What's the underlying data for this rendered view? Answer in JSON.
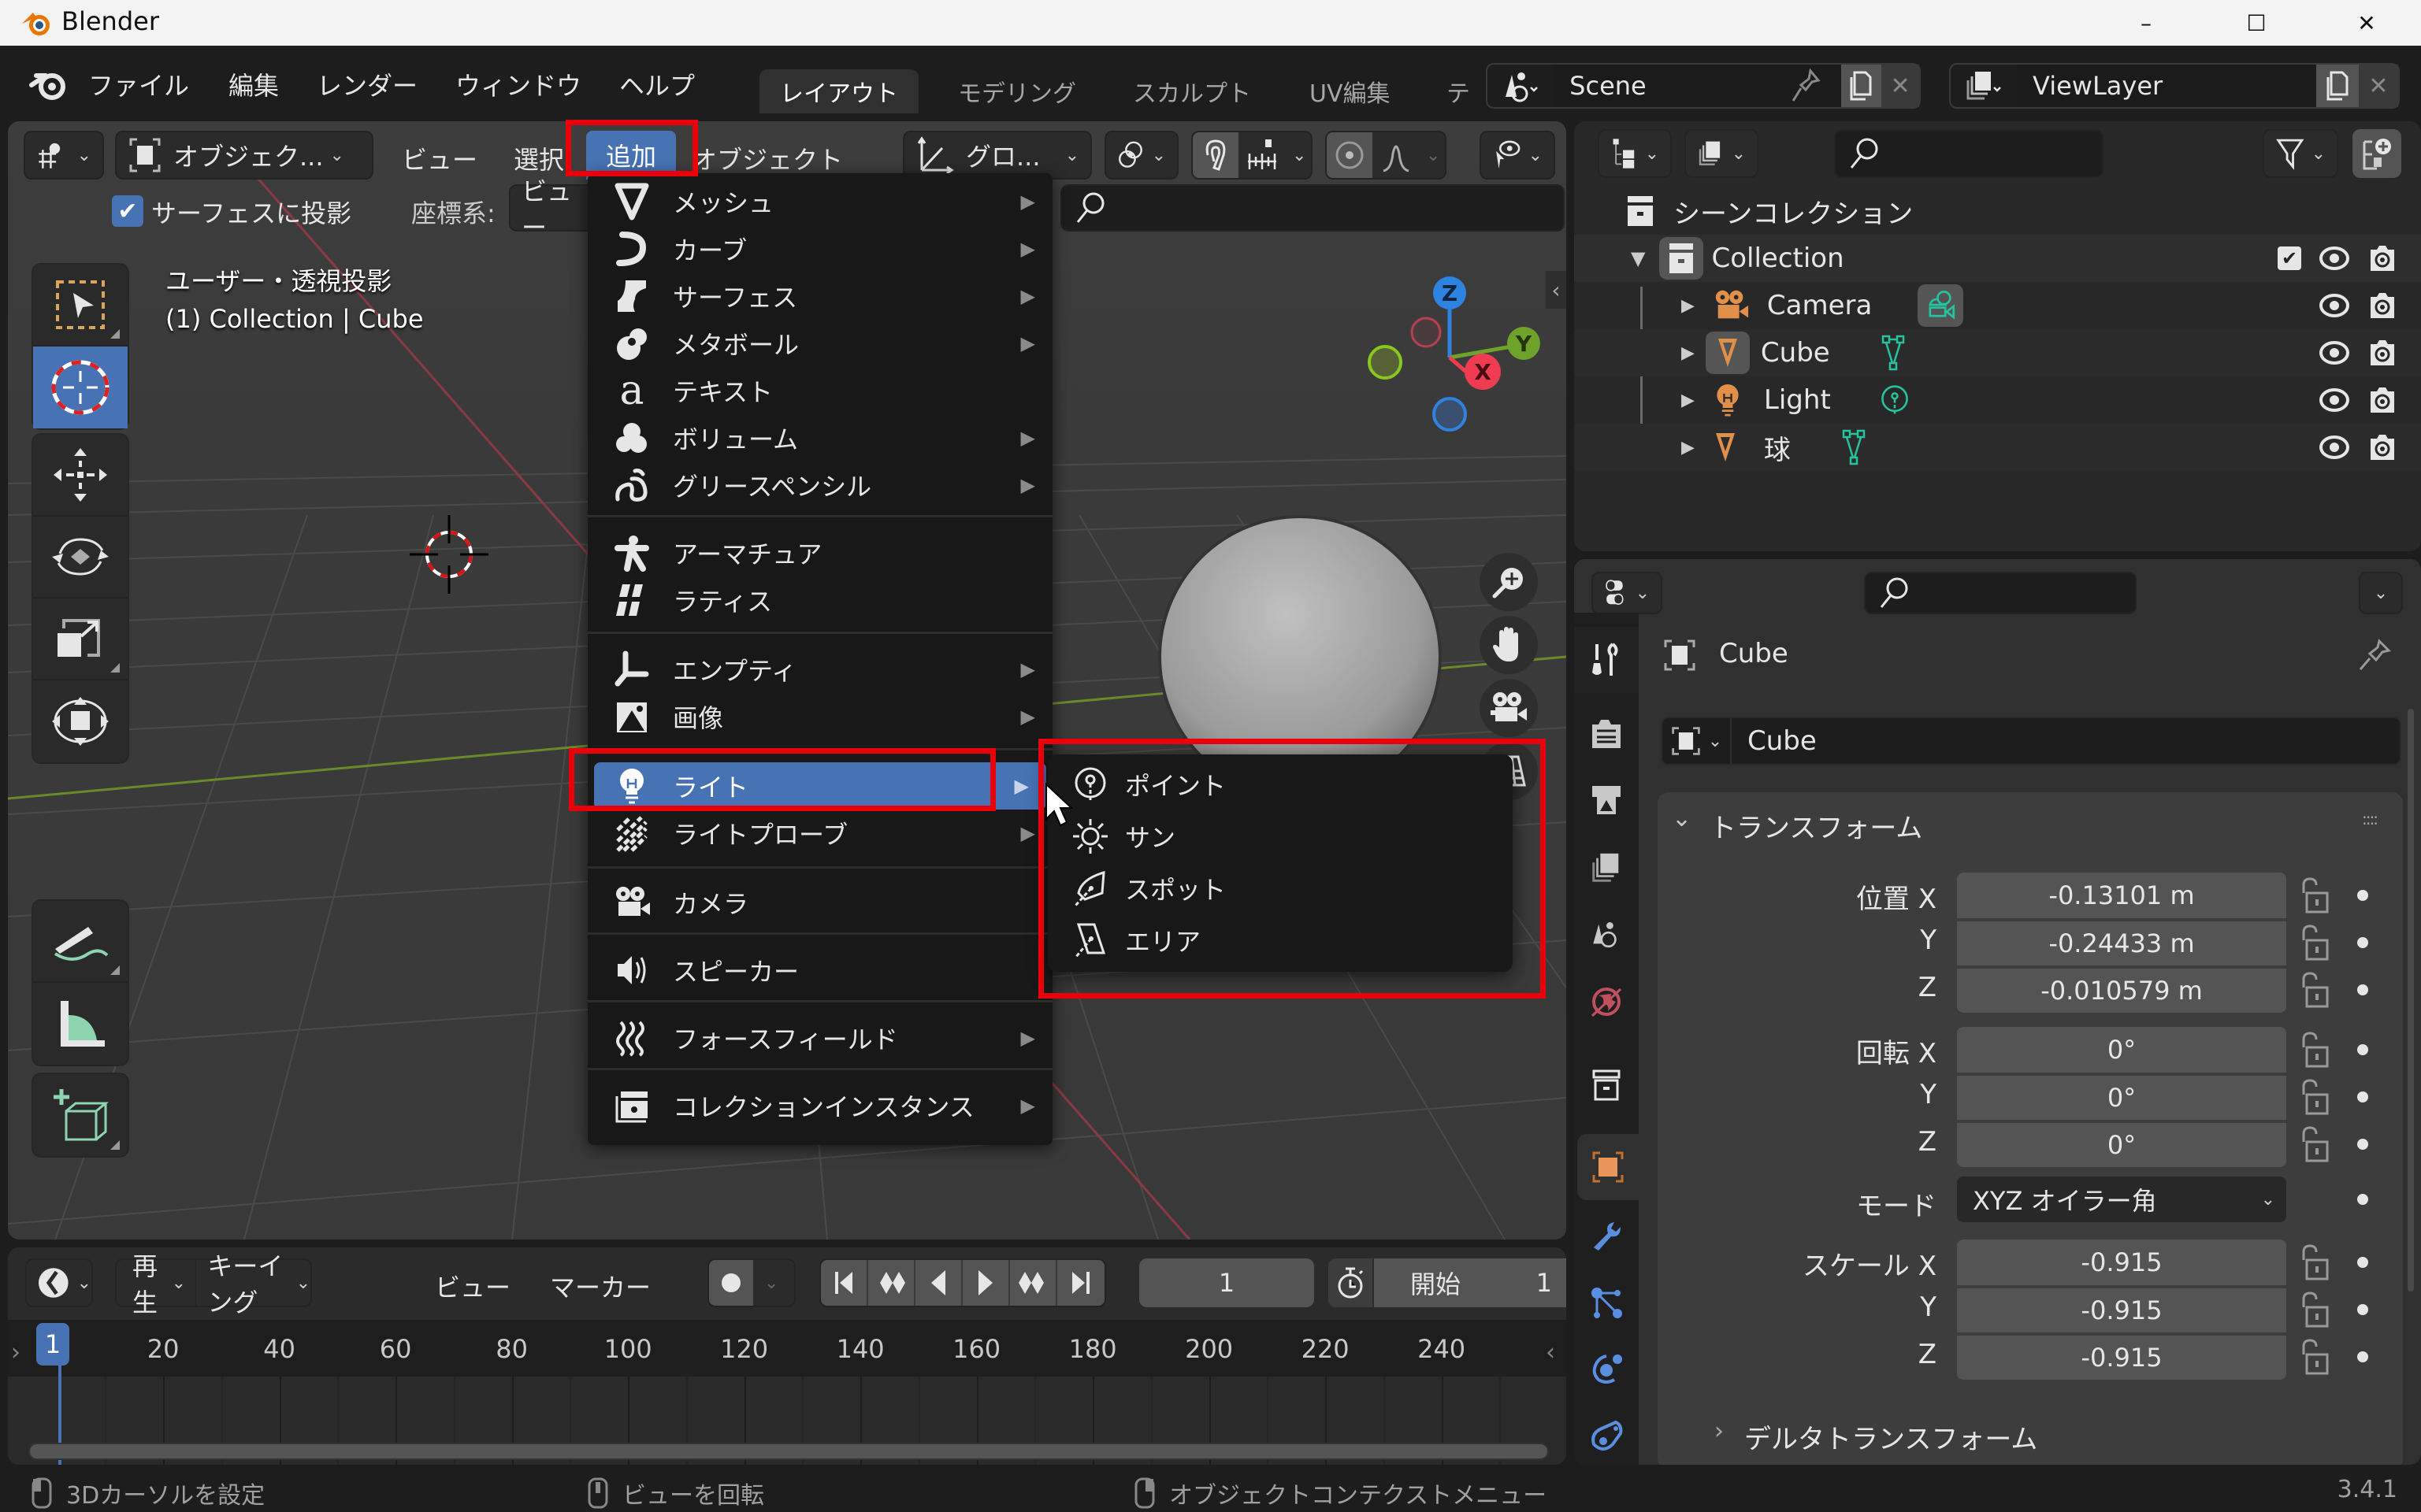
{
  "window": {
    "app_title": "Blender",
    "minimize": "–",
    "maximize": "☐",
    "close": "✕"
  },
  "topbar": {
    "menus": [
      "ファイル",
      "編集",
      "レンダー",
      "ウィンドウ",
      "ヘルプ"
    ],
    "workspace_tabs": [
      {
        "label": "レイアウト",
        "active": true
      },
      {
        "label": "モデリング",
        "active": false
      },
      {
        "label": "スカルプト",
        "active": false
      },
      {
        "label": "UV編集",
        "active": false
      },
      {
        "label": "テ",
        "active": false
      }
    ],
    "scene_name": "Scene",
    "view_layer_name": "ViewLayer"
  },
  "viewport": {
    "mode_label": "オブジェク...",
    "menus": {
      "view": "ビュー",
      "select": "選択",
      "add": "追加",
      "object": "オブジェクト"
    },
    "transform_orientation": "グロ...",
    "snap_surface_label": "サーフェスに投影",
    "snap_surface_checked": true,
    "coord_label": "座標系:",
    "coord_value": "ビュー",
    "overlay_line1": "ユーザー・透視投影",
    "overlay_line2": "(1) Collection | Cube",
    "gizmo_axes": {
      "x": "X",
      "y": "Y",
      "z": "Z"
    }
  },
  "add_menu": {
    "items": [
      {
        "label": "メッシュ",
        "icon": "mesh-icon",
        "submenu": true
      },
      {
        "label": "カーブ",
        "icon": "curve-icon",
        "submenu": true
      },
      {
        "label": "サーフェス",
        "icon": "surface-icon",
        "submenu": true
      },
      {
        "label": "メタボール",
        "icon": "metaball-icon",
        "submenu": true
      },
      {
        "label": "テキスト",
        "icon": "text-icon",
        "submenu": false
      },
      {
        "label": "ボリューム",
        "icon": "volume-icon",
        "submenu": true
      },
      {
        "label": "グリースペンシル",
        "icon": "grease-pencil-icon",
        "submenu": true
      },
      {
        "label": "アーマチュア",
        "icon": "armature-icon",
        "submenu": false
      },
      {
        "label": "ラティス",
        "icon": "lattice-icon",
        "submenu": false
      },
      {
        "label": "エンプティ",
        "icon": "empty-icon",
        "submenu": true
      },
      {
        "label": "画像",
        "icon": "image-icon",
        "submenu": true
      },
      {
        "label": "ライト",
        "icon": "light-icon",
        "submenu": true,
        "highlighted": true
      },
      {
        "label": "ライトプローブ",
        "icon": "light-probe-icon",
        "submenu": true
      },
      {
        "label": "カメラ",
        "icon": "camera-icon",
        "submenu": false
      },
      {
        "label": "スピーカー",
        "icon": "speaker-icon",
        "submenu": false
      },
      {
        "label": "フォースフィールド",
        "icon": "force-field-icon",
        "submenu": true
      },
      {
        "label": "コレクションインスタンス",
        "icon": "collection-instance-icon",
        "submenu": true
      }
    ]
  },
  "light_submenu": {
    "items": [
      {
        "label": "ポイント",
        "icon": "point-light-icon"
      },
      {
        "label": "サン",
        "icon": "sun-light-icon"
      },
      {
        "label": "スポット",
        "icon": "spot-light-icon"
      },
      {
        "label": "エリア",
        "icon": "area-light-icon"
      }
    ]
  },
  "outliner": {
    "scene_collection": "シーンコレクション",
    "collection": "Collection",
    "objects": [
      {
        "name": "Camera",
        "type": "camera"
      },
      {
        "name": "Cube",
        "type": "mesh"
      },
      {
        "name": "Light",
        "type": "light"
      },
      {
        "name": "球",
        "type": "mesh"
      }
    ]
  },
  "properties": {
    "object_name": "Cube",
    "datablock_name": "Cube",
    "panel_title": "トランスフォーム",
    "location": {
      "label": "位置 X",
      "x": "-0.13101 m",
      "y": "-0.24433 m",
      "z": "-0.010579 m"
    },
    "rotation": {
      "label": "回転 X",
      "x": "0°",
      "y": "0°",
      "z": "0°"
    },
    "mode_label": "モード",
    "mode_value": "XYZ オイラー角",
    "scale": {
      "label": "スケール X",
      "x": "-0.915",
      "y": "-0.915",
      "z": "-0.915"
    },
    "axis_y": "Y",
    "axis_z": "Z",
    "delta_panel": "デルタトランスフォーム"
  },
  "timeline": {
    "playback": "再生",
    "keying": "キーイング",
    "view": "ビュー",
    "marker": "マーカー",
    "current_frame": "1",
    "start_label": "開始",
    "start_value": "1",
    "playhead_frame": "1",
    "ruler_ticks": [
      "20",
      "40",
      "60",
      "80",
      "100",
      "120",
      "140",
      "160",
      "180",
      "200",
      "220",
      "240"
    ]
  },
  "statusbar": {
    "left": "3Dカーソルを設定",
    "middle": "ビューを回転",
    "right": "オブジェクトコンテクストメニュー",
    "version": "3.4.1"
  },
  "colors": {
    "accent_blue": "#4772b3",
    "highlight_red": "#e8000b",
    "object_orange": "#e0904a",
    "data_teal": "#25c3a0",
    "axis_x": "#f03c52",
    "axis_y": "#6fa22b",
    "axis_z": "#2f83e0"
  }
}
